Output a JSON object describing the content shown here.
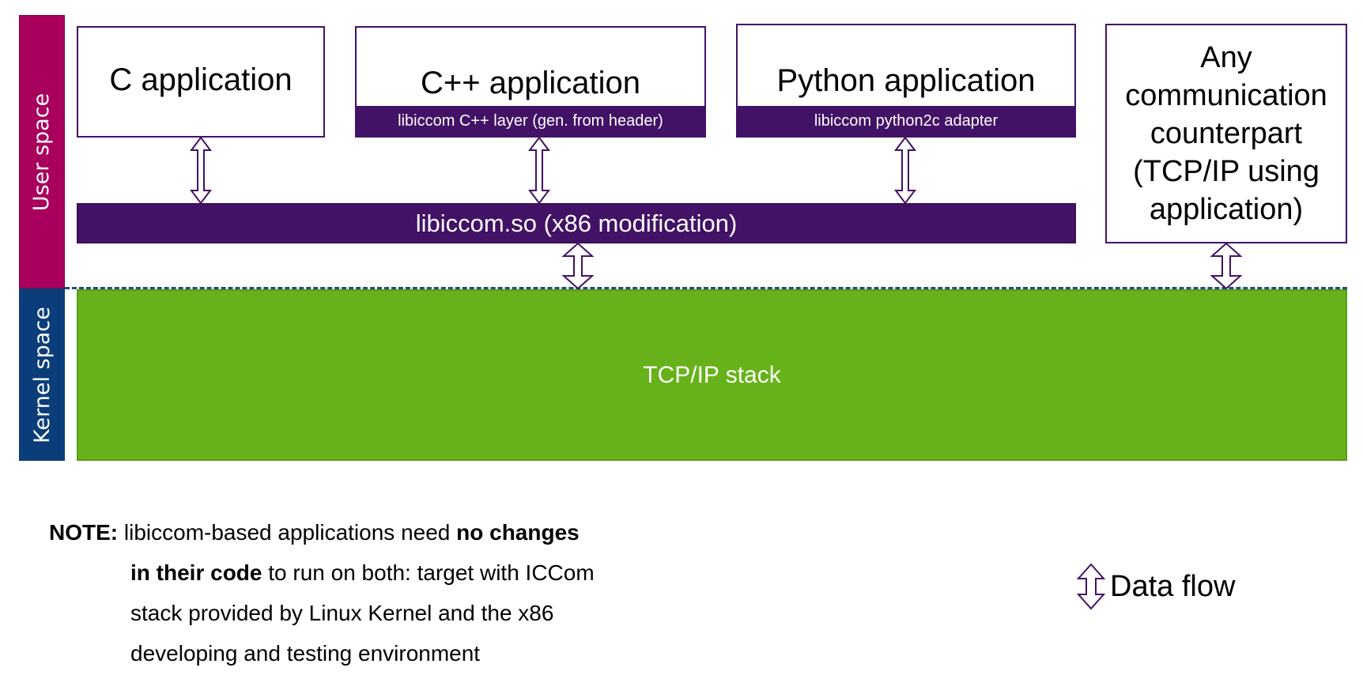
{
  "side_labels": {
    "user_space": "User space",
    "kernel_space": "Kernel space"
  },
  "apps": {
    "c": {
      "title": "C application"
    },
    "cpp": {
      "title": "C++ application",
      "layer": "libiccom C++ layer (gen. from header)"
    },
    "python": {
      "title": "Python application",
      "layer": "libiccom python2c adapter"
    },
    "counterpart": {
      "lines": [
        "Any",
        "communication",
        "counterpart",
        "(TCP/IP using",
        "application)"
      ]
    }
  },
  "library": {
    "label": "libiccom.so (x86 modification)"
  },
  "kernel": {
    "label": "TCP/IP stack"
  },
  "note": {
    "prefix": "NOTE:",
    "line1_normal": " libiccom-based applications need ",
    "line1_bold": "no changes",
    "line2_bold": "in their code",
    "line2_normal": " to run on both: target with ICCom",
    "line3": "stack provided by Linux Kernel and the x86",
    "line4": "developing and testing environment"
  },
  "legend": {
    "icon": "double-arrow-icon",
    "label": "Data flow"
  },
  "colors": {
    "purple": "#421266",
    "user_space": "#a8005c",
    "kernel_space": "#0b3d7a",
    "tcpip": "#67b21a",
    "dashed": "#1f4e79"
  }
}
